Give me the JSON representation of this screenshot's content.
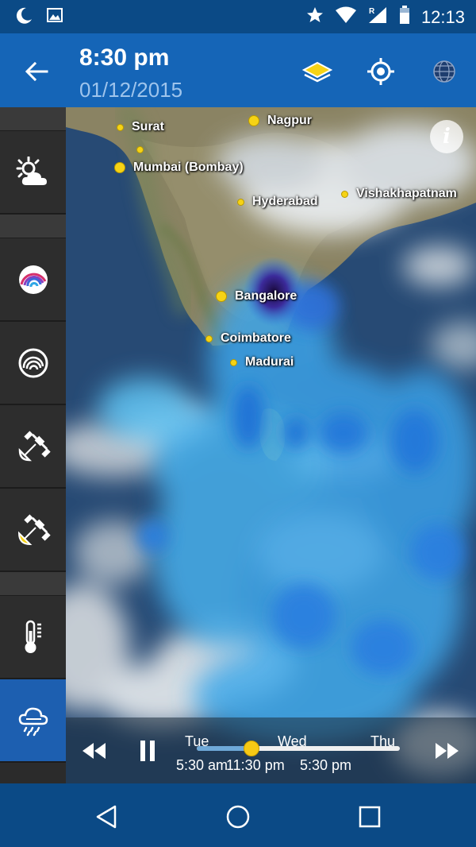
{
  "status_bar": {
    "time": "12:13",
    "icons": [
      "moon-icon",
      "image-icon",
      "star-icon",
      "wifi-icon",
      "signal-roaming-icon",
      "battery-icon"
    ]
  },
  "app_bar": {
    "time": "8:30 pm",
    "date": "01/12/2015",
    "actions": [
      "layers-icon",
      "my-location-icon",
      "globe-icon"
    ]
  },
  "sidebar": {
    "items": [
      {
        "name": "sidebar-item-forecast",
        "icon": "sun-cloud-icon"
      },
      {
        "name": "sidebar-item-radar-color",
        "icon": "radar-color-icon"
      },
      {
        "name": "sidebar-item-radar",
        "icon": "radar-icon"
      },
      {
        "name": "sidebar-item-satellite",
        "icon": "satellite-icon"
      },
      {
        "name": "sidebar-item-satellite-visible",
        "icon": "satellite-sun-icon"
      },
      {
        "name": "sidebar-item-temperature",
        "icon": "thermometer-icon"
      },
      {
        "name": "sidebar-item-rain",
        "icon": "rain-cloud-icon",
        "active": true
      }
    ]
  },
  "map": {
    "cities": [
      {
        "name": "Surat",
        "size": "small"
      },
      {
        "name": "",
        "size": "small"
      },
      {
        "name": "Mumbai (Bombay)",
        "size": "big"
      },
      {
        "name": "Nagpur",
        "size": "big"
      },
      {
        "name": "Hyderabad",
        "size": "small"
      },
      {
        "name": "Vishakhapatnam",
        "size": "small"
      },
      {
        "name": "Bangalore",
        "size": "big"
      },
      {
        "name": "Coimbatore",
        "size": "small"
      },
      {
        "name": "Madurai",
        "size": "small"
      }
    ],
    "info_label": "i"
  },
  "timeline": {
    "days": [
      "Tue",
      "Wed",
      "Thu"
    ],
    "times": [
      "5:30 am",
      "11:30 pm",
      "5:30 pm"
    ],
    "progress": 0.27
  },
  "colors": {
    "app_bar": "#1565b7",
    "status_bar": "#0b4a86",
    "sidebar_active": "#1d5fb0",
    "city_dot": "#f6d315"
  }
}
